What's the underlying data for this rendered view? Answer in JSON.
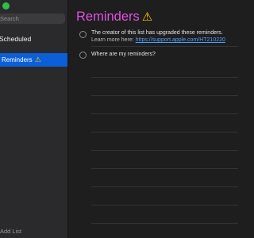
{
  "sidebar": {
    "search_placeholder": "Search",
    "scheduled_label": "Scheduled",
    "selected_list": "Reminders",
    "add_list_label": "Add List"
  },
  "main": {
    "title": "Reminders",
    "reminders": [
      {
        "text": "The creator of this list has upgraded these reminders.",
        "sub_prefix": "Learn more here:",
        "sub_link": "https://support.apple.com/HT210220"
      },
      {
        "text": "Where are my reminders?"
      }
    ]
  },
  "colors": {
    "accent": "#e14fe4",
    "selection": "#0b5fd8",
    "link": "#4ea1ff",
    "warning": "#ffcc00"
  }
}
